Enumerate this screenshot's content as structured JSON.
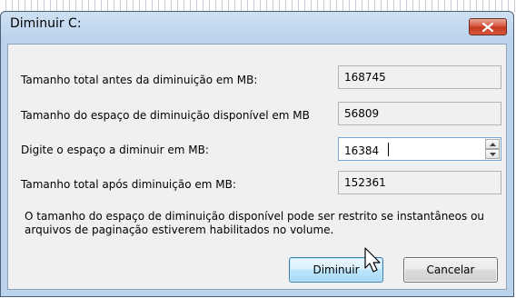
{
  "dialog": {
    "title": "Diminuir C:",
    "close_icon": "close-x-icon"
  },
  "fields": [
    {
      "label": "Tamanho total antes da diminuição em MB:",
      "value": "168745"
    },
    {
      "label": "Tamanho do espaço de diminuição disponível em MB",
      "value": "56809"
    },
    {
      "label": "Digite o espaço a diminuir em MB:",
      "value": "16384"
    },
    {
      "label": "Tamanho total após diminuição em MB:",
      "value": "152361"
    }
  ],
  "note": "O tamanho do espaço de diminuição disponível pode ser restrito se instantâneos ou arquivos de paginação estiverem habilitados no volume.",
  "buttons": {
    "shrink_label": "Diminuir",
    "cancel_label": "Cancelar"
  },
  "colors": {
    "close_button": "#c33a1f",
    "title_bar": "#bcd3ec",
    "client_bg": "#f0f0f0",
    "focus_border": "#7aa7d6"
  }
}
